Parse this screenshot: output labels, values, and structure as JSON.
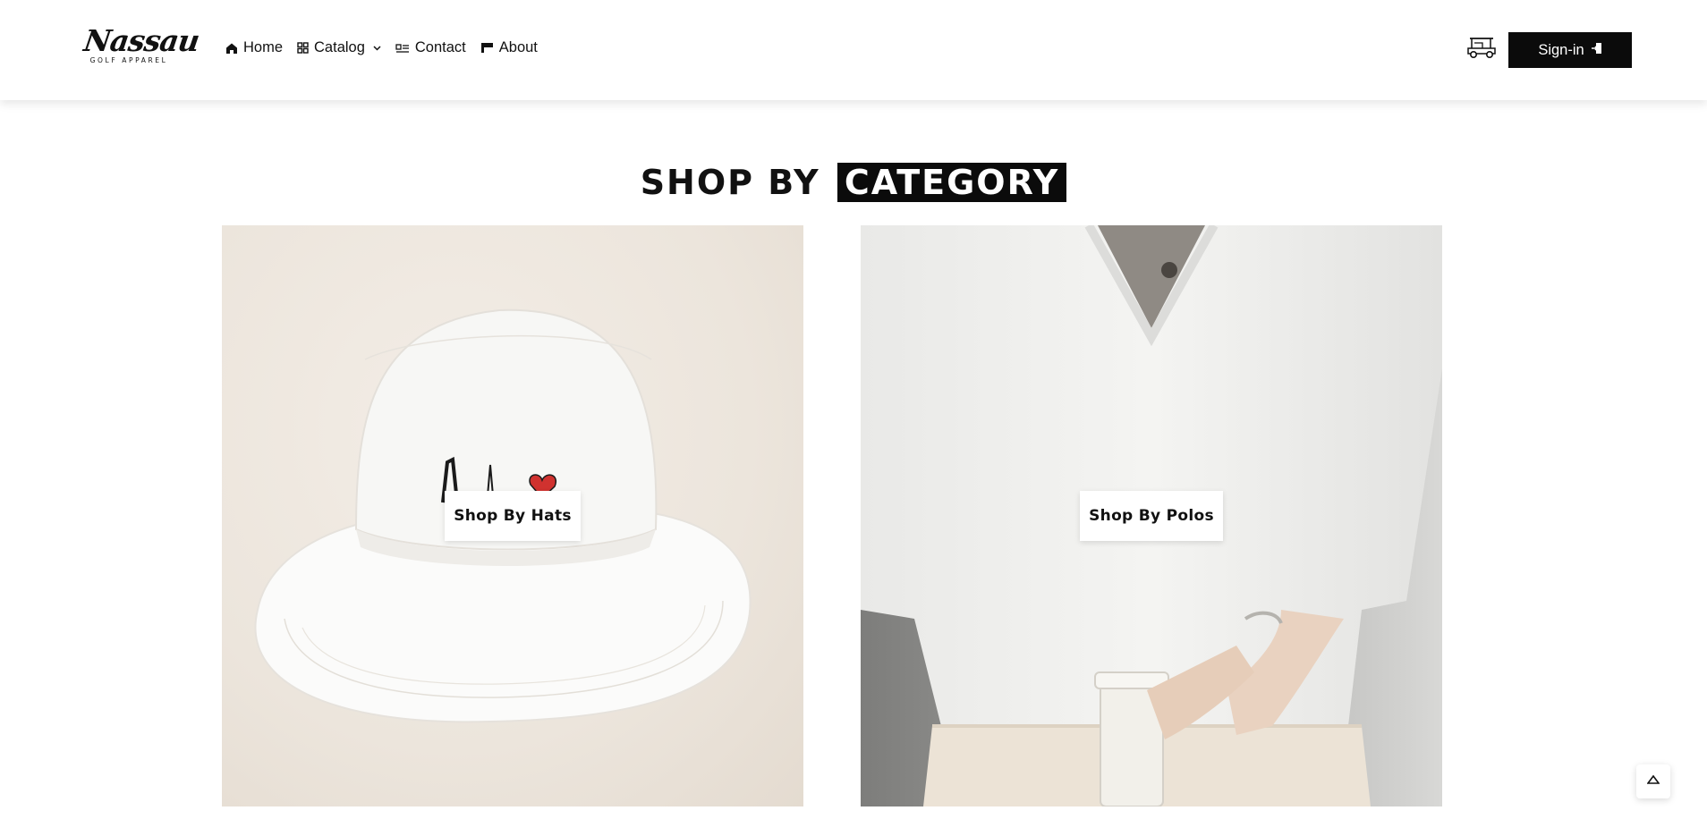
{
  "brand": {
    "logo_script": "Nassau",
    "logo_sub": "GOLF APPAREL"
  },
  "nav": {
    "items": [
      {
        "label": "Home",
        "icon": "home-icon"
      },
      {
        "label": "Catalog",
        "icon": "grid-icon",
        "has_dropdown": true
      },
      {
        "label": "Contact",
        "icon": "contact-card-icon"
      },
      {
        "label": "About",
        "icon": "flag-icon"
      }
    ]
  },
  "header_actions": {
    "cart_icon": "golf-cart-icon",
    "signin_label": "Sign-in",
    "signin_icon": "login-door-icon"
  },
  "section": {
    "title_plain": "SHOP BY",
    "title_highlight": "CATEGORY"
  },
  "categories": [
    {
      "button_label": "Shop By Hats",
      "image": "white bucket hat"
    },
    {
      "button_label": "Shop By Polos",
      "image": "white v-neck shirt"
    }
  ],
  "colors": {
    "accent": "#0b0b0b",
    "background": "#ffffff"
  },
  "back_to_top_icon": "chevron-up-icon"
}
